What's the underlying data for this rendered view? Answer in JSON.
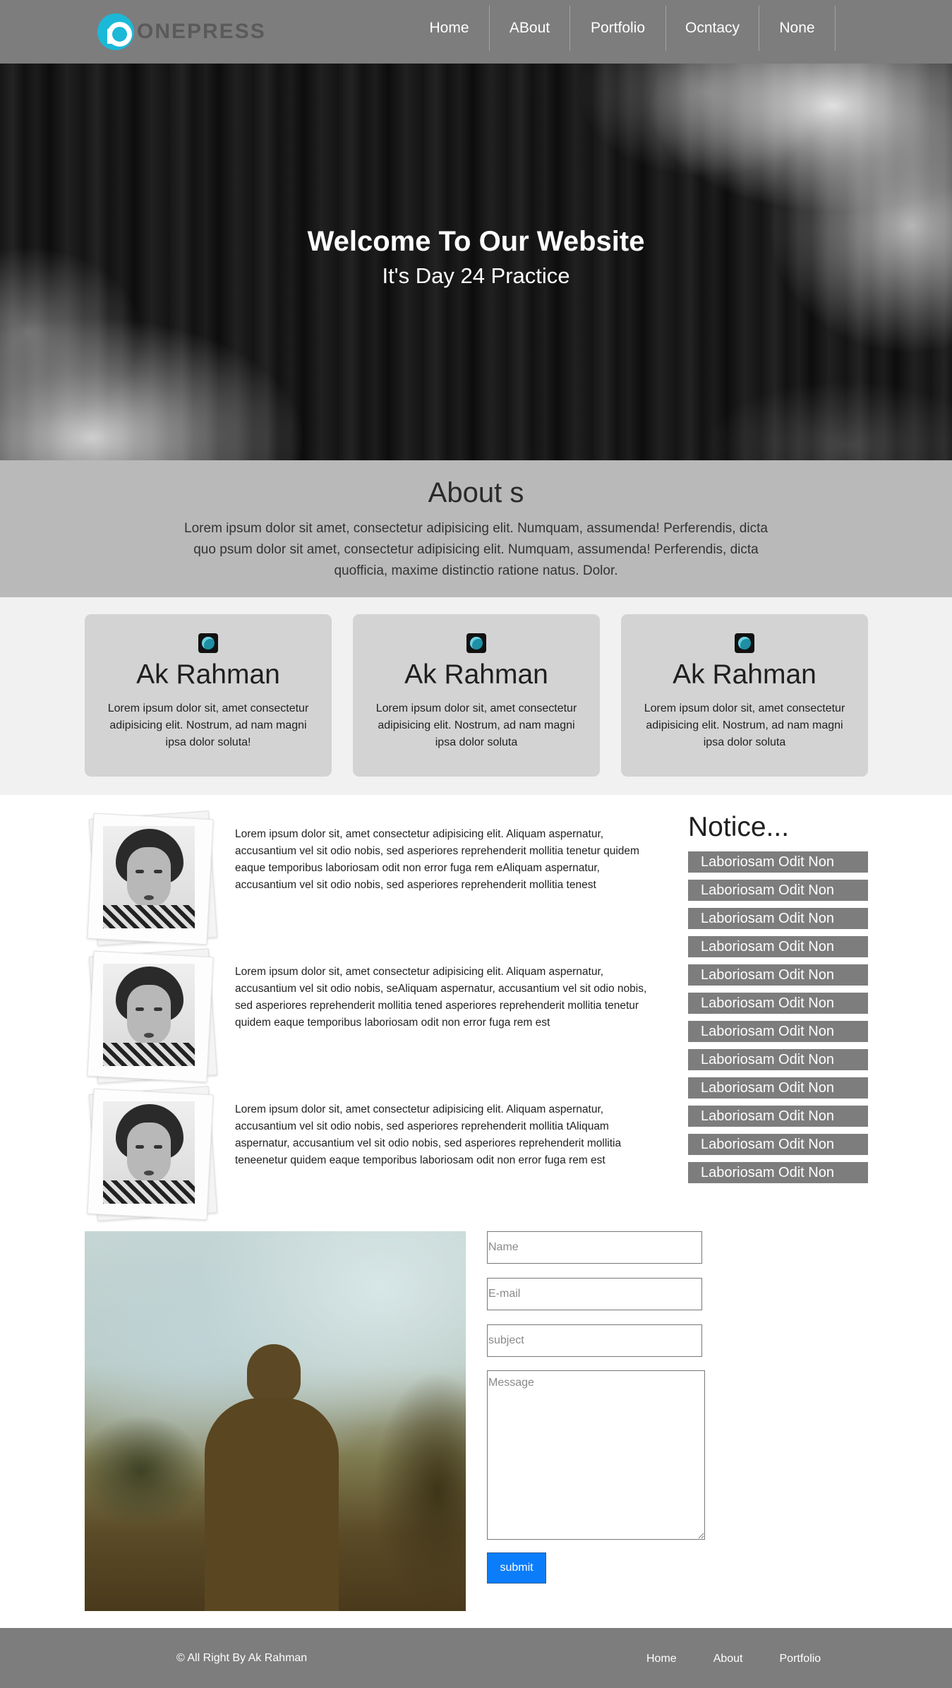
{
  "header": {
    "logo_text": "ONEPRESS",
    "nav": [
      "Home",
      "ABout",
      "Portfolio",
      "Ocntacy",
      "None"
    ]
  },
  "hero": {
    "title": "Welcome To Our Website",
    "subtitle": "It's Day 24 Practice"
  },
  "about": {
    "title": "About s",
    "text": "Lorem ipsum dolor sit amet, consectetur adipisicing elit. Numquam, assumenda! Perferendis, dicta quo psum dolor sit amet, consectetur adipisicing elit. Numquam, assumenda! Perferendis, dicta quofficia, maxime distinctio ratione natus. Dolor."
  },
  "cards": [
    {
      "title": "Ak Rahman",
      "text": "Lorem ipsum dolor sit, amet consectetur adipisicing elit. Nostrum, ad nam magni ipsa dolor soluta!"
    },
    {
      "title": "Ak Rahman",
      "text": "Lorem ipsum dolor sit, amet consectetur adipisicing elit. Nostrum, ad nam magni ipsa dolor soluta"
    },
    {
      "title": "Ak Rahman",
      "text": "Lorem ipsum dolor sit, amet consectetur adipisicing elit. Nostrum, ad nam magni ipsa dolor soluta"
    }
  ],
  "posts": [
    {
      "text": "Lorem ipsum dolor sit, amet consectetur adipisicing elit. Aliquam aspernatur, accusantium vel sit odio nobis, sed asperiores reprehenderit mollitia tenetur quidem eaque temporibus laboriosam odit non error fuga rem eAliquam aspernatur, accusantium vel sit odio nobis, sed asperiores reprehenderit mollitia tenest"
    },
    {
      "text": "Lorem ipsum dolor sit, amet consectetur adipisicing elit. Aliquam aspernatur, accusantium vel sit odio nobis, seAliquam aspernatur, accusantium vel sit odio nobis, sed asperiores reprehenderit mollitia tened asperiores reprehenderit mollitia tenetur quidem eaque temporibus laboriosam odit non error fuga rem est"
    },
    {
      "text": "Lorem ipsum dolor sit, amet consectetur adipisicing elit. Aliquam aspernatur, accusantium vel sit odio nobis, sed asperiores reprehenderit mollitia tAliquam aspernatur, accusantium vel sit odio nobis, sed asperiores reprehenderit mollitia teneenetur quidem eaque temporibus laboriosam odit non error fuga rem est"
    }
  ],
  "notice": {
    "title": "Notice...",
    "items": [
      "Laboriosam Odit Non",
      "Laboriosam Odit Non",
      "Laboriosam Odit Non",
      "Laboriosam Odit Non",
      "Laboriosam Odit Non",
      "Laboriosam Odit Non",
      "Laboriosam Odit Non",
      "Laboriosam Odit Non",
      "Laboriosam Odit Non",
      "Laboriosam Odit Non",
      "Laboriosam Odit Non",
      "Laboriosam Odit Non"
    ]
  },
  "contact": {
    "name_placeholder": "Name",
    "email_placeholder": "E-mail",
    "subject_placeholder": "subject",
    "message_placeholder": "Message",
    "submit_label": "submit"
  },
  "footer": {
    "copyright": "© All Right By Ak Rahman",
    "nav": [
      "Home",
      "About",
      "Portfolio"
    ]
  },
  "colors": {
    "header_bg": "#7d7d7d",
    "about_bg": "#b9b9b9",
    "card_bg": "#d3d3d3",
    "notice_item_bg": "#7d7d7d",
    "logo_accent": "#1cb8d8",
    "submit_bg": "#0b7dfb"
  }
}
